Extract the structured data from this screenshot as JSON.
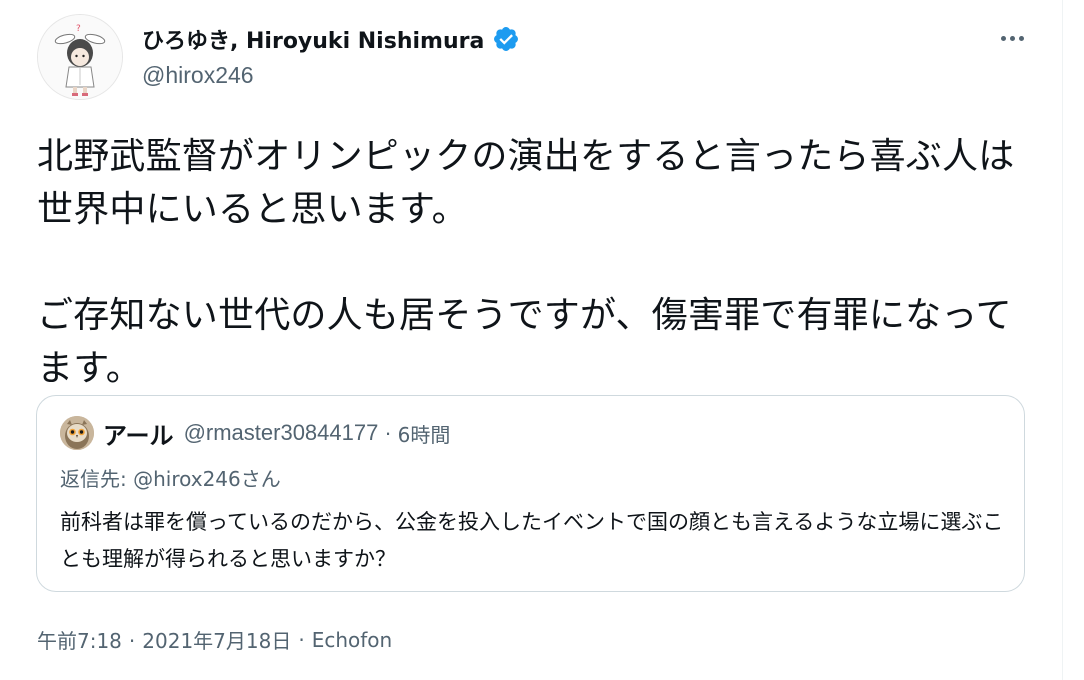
{
  "author": {
    "display_name": "ひろゆき, Hiroyuki Nishimura",
    "handle": "@hirox246",
    "verified": true,
    "verified_color": "#1d9bf0"
  },
  "tweet": {
    "text": "北野武監督がオリンピックの演出をすると言ったら喜ぶ人は世界中にいると思います。\n\nご存知ない世代の人も居そうですが、傷害罪で有罪になってます。"
  },
  "quoted_tweet": {
    "display_name": "アール",
    "handle": "@rmaster30844177",
    "separator": "·",
    "time": "6時間",
    "reply_prefix": "返信先: ",
    "reply_to": "@hirox246さん",
    "text": "前科者は罪を償っているのだから、公金を投入したイベントで国の顔とも言えるような立場に選ぶことも理解が得られると思いますか？"
  },
  "meta": {
    "time": "午前7:18",
    "separator": "·",
    "date": "2021年7月18日",
    "client": "Echofon"
  },
  "icons": {
    "more": "more-horizontal-icon",
    "verified": "verified-badge-icon"
  },
  "colors": {
    "text_primary": "#0f1419",
    "text_secondary": "#536471",
    "border": "#cfd9de",
    "accent": "#1d9bf0"
  }
}
